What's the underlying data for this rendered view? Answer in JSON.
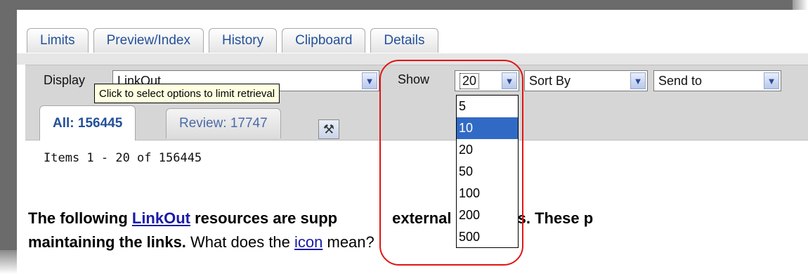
{
  "tabs": [
    "Limits",
    "Preview/Index",
    "History",
    "Clipboard",
    "Details"
  ],
  "toolbar": {
    "display_label": "Display",
    "display_value": "LinkOut",
    "show_label": "Show",
    "show_value": "20",
    "sort_value": "Sort By",
    "send_value": "Send to"
  },
  "tooltip": "Click to select options to limit retrieval",
  "subtabs": {
    "all": "All: 156445",
    "review": "Review: 17747"
  },
  "items_text": "Items 1 - 20 of 156445",
  "body_text": {
    "line1_prefix": "The following ",
    "line1_link": "LinkOut",
    "line1_rest_a": " resources are supp",
    "line1_rest_b": "external providers. These p",
    "line2_bold": "maintaining the links.",
    "line2_text_a": " What does the ",
    "line2_link": "icon",
    "line2_text_b": " mean?"
  },
  "dropdown_options": [
    "5",
    "10",
    "20",
    "50",
    "100",
    "200",
    "500"
  ],
  "selected_option": "10",
  "colors": {
    "selection": "#316ac5",
    "highlight_circle": "#e01414",
    "link": "#1a1aa6"
  }
}
